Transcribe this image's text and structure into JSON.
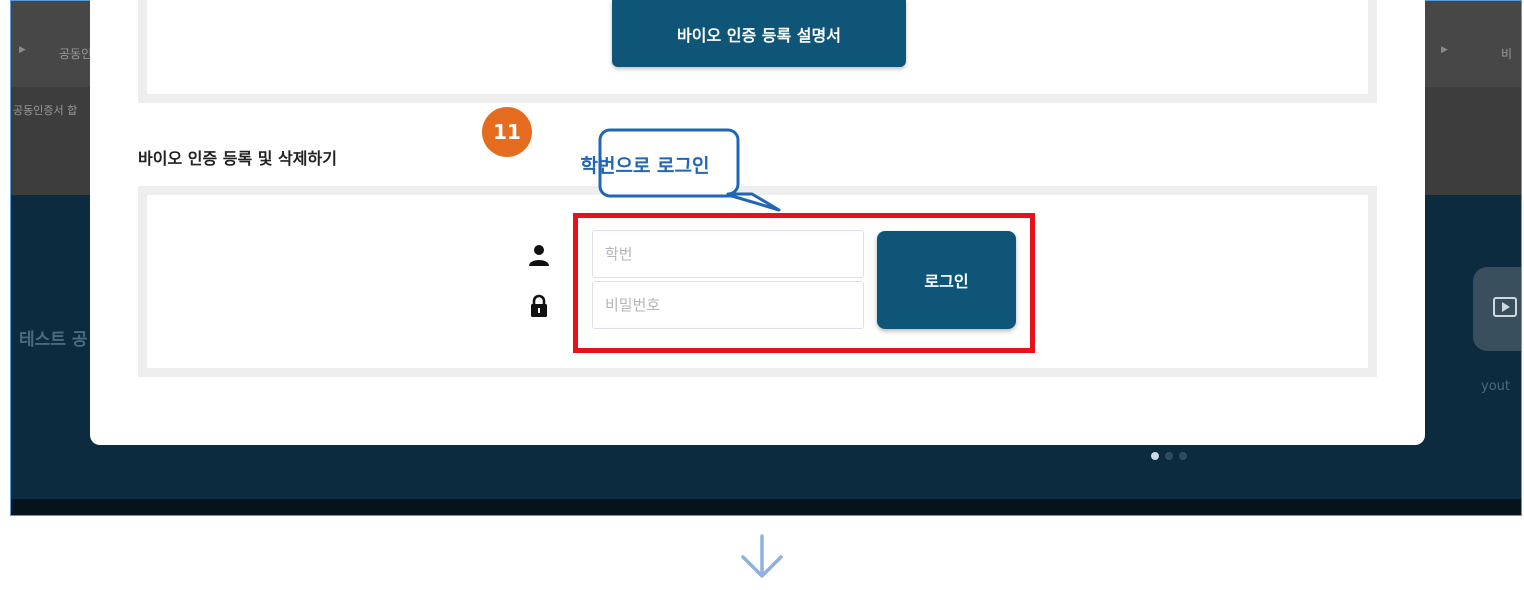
{
  "background": {
    "nav_left_label": "공동인",
    "nav_right_label": "비",
    "sub_left_label": "공동인증서 합",
    "hero_text": "테스트 공",
    "hero_side_label": "yout",
    "youtube_icon": "video-play-icon"
  },
  "modal": {
    "guide_button_label": "바이오 인증 등록 설명서",
    "section_title": "바이오 인증 등록 및 삭제하기",
    "student_id_placeholder": "학번",
    "password_placeholder": "비밀번호",
    "login_button_label": "로그인",
    "user_icon": "user-icon",
    "lock_icon": "lock-icon"
  },
  "annotation": {
    "step_number": "11",
    "callout_text": "학번으로 로그인",
    "highlight_color": "#e8101b"
  },
  "colors": {
    "primary_button": "#0f5577",
    "badge": "#e56b1f",
    "callout_text": "#1f66b7"
  },
  "flow_arrow_icon": "arrow-down-icon"
}
